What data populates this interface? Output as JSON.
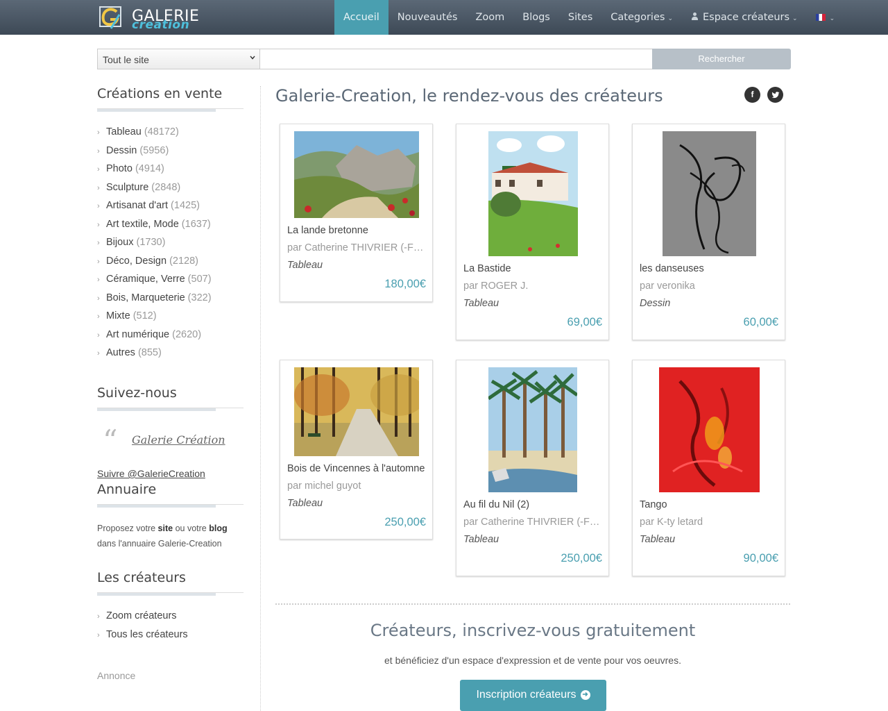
{
  "brand": {
    "line1": "Galerie",
    "line2": "creation"
  },
  "nav": {
    "items": [
      {
        "label": "Accueil",
        "active": true
      },
      {
        "label": "Nouveautés"
      },
      {
        "label": "Zoom"
      },
      {
        "label": "Blogs"
      },
      {
        "label": "Sites"
      },
      {
        "label": "Categories",
        "dropdown": true
      },
      {
        "label": "Espace créateurs",
        "dropdown": true,
        "icon": "user-icon"
      }
    ],
    "language": "fr"
  },
  "search": {
    "scope_selected": "Tout le site",
    "query_value": "",
    "button_label": "Rechercher"
  },
  "sidebar": {
    "categories_heading": "Créations en vente",
    "categories": [
      {
        "label": "Tableau",
        "count": "(48172)"
      },
      {
        "label": "Dessin",
        "count": "(5956)"
      },
      {
        "label": "Photo",
        "count": "(4914)"
      },
      {
        "label": "Sculpture",
        "count": "(2848)"
      },
      {
        "label": "Artisanat d'art",
        "count": "(1425)"
      },
      {
        "label": "Art textile, Mode",
        "count": "(1637)"
      },
      {
        "label": "Bijoux",
        "count": "(1730)"
      },
      {
        "label": "Déco, Design",
        "count": "(2128)"
      },
      {
        "label": "Céramique, Verre",
        "count": "(507)"
      },
      {
        "label": "Bois, Marqueterie",
        "count": "(322)"
      },
      {
        "label": "Mixte",
        "count": "(512)"
      },
      {
        "label": "Art numérique",
        "count": "(2620)"
      },
      {
        "label": "Autres",
        "count": "(855)"
      }
    ],
    "follow_heading": "Suivez-nous",
    "quote_link": "Galerie Création",
    "twitter_link": "Suivre @GalerieCreation",
    "directory_heading": "Annuaire",
    "directory_text": {
      "p1": "Proposez votre ",
      "b1": "site",
      "p2": " ou votre ",
      "b2": "blog",
      "p3": "dans l'annuaire Galerie-Creation"
    },
    "creators_heading": "Les créateurs",
    "creators_links": [
      "Zoom créateurs",
      "Tous les créateurs"
    ],
    "annonce": "Annonce"
  },
  "main": {
    "title": "Galerie-Creation, le rendez-vous des créateurs",
    "social": [
      "facebook-icon",
      "twitter-icon"
    ],
    "artworks": [
      {
        "title": "La lande bretonne",
        "author": "par Catherine THIVRIER (-Fornelli-)",
        "category": "Tableau",
        "price": "180,00€"
      },
      {
        "title": "La Bastide",
        "author": "par ROGER J.",
        "category": "Tableau",
        "price": "69,00€"
      },
      {
        "title": "les danseuses",
        "author": "par veronika",
        "category": "Dessin",
        "price": "60,00€"
      },
      {
        "title": "Bois de Vincennes à l'automne",
        "author": "par michel guyot",
        "category": "Tableau",
        "price": "250,00€"
      },
      {
        "title": "Au fil du Nil (2)",
        "author": "par Catherine THIVRIER (-Fornelli-)",
        "category": "Tableau",
        "price": "250,00€"
      },
      {
        "title": "Tango",
        "author": "par K-ty letard",
        "category": "Tableau",
        "price": "90,00€"
      }
    ],
    "cta": {
      "title": "Créateurs, inscrivez-vous gratuitement",
      "text": "et bénéficiez d'un espace d'expression et de vente pour vos oeuvres.",
      "button": "Inscription créateurs"
    }
  },
  "colors": {
    "accent": "#4a9fb0",
    "navbar": "#4a5663",
    "price": "#4a9fb0"
  }
}
